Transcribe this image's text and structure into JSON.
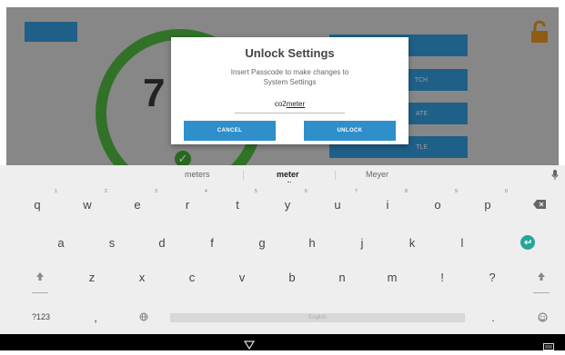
{
  "app": {
    "top_button_label": "",
    "gauge_value": "7",
    "side_buttons": [
      "",
      "TCH",
      "ATE",
      "TLE"
    ]
  },
  "dialog": {
    "title": "Unlock Settings",
    "message": "Insert Passcode to make changes to System Settings",
    "passcode_prefix": "co2",
    "passcode_typed": "meter",
    "cancel_label": "CANCEL",
    "unlock_label": "UNLOCK"
  },
  "keyboard": {
    "suggestions": [
      "meters",
      "meter",
      "Meyer"
    ],
    "row1": [
      "q",
      "w",
      "e",
      "r",
      "t",
      "y",
      "u",
      "i",
      "o",
      "p"
    ],
    "row1_hints": [
      "1",
      "2",
      "3",
      "4",
      "5",
      "6",
      "7",
      "8",
      "9",
      "0"
    ],
    "row2": [
      "a",
      "s",
      "d",
      "f",
      "g",
      "h",
      "j",
      "k",
      "l"
    ],
    "row3": [
      "z",
      "x",
      "c",
      "v",
      "b",
      "n",
      "m",
      "!",
      "?"
    ],
    "symbols_key": "?123",
    "comma_key": ",",
    "period_key": ".",
    "space_label": "English"
  },
  "colors": {
    "accent": "#2f8fcb",
    "gauge": "#4aab3c",
    "enter_key": "#26a69a"
  },
  "icons": {
    "lock": "lock-open-icon",
    "mic": "microphone-icon",
    "backspace": "backspace-icon",
    "enter": "enter-icon",
    "shift": "shift-icon",
    "globe": "globe-icon",
    "emoji": "emoji-icon",
    "back": "nav-back-icon",
    "keyboard": "keyboard-switch-icon"
  }
}
